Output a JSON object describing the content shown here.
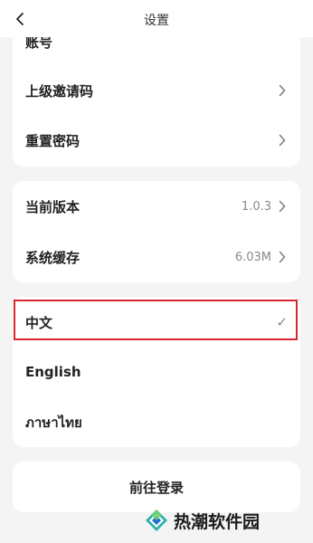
{
  "header": {
    "title": "设置",
    "back_icon": "chevron-left-icon"
  },
  "account_card": {
    "items": [
      {
        "label": "账号"
      },
      {
        "label": "上级邀请码",
        "icon": "chevron-right-icon"
      },
      {
        "label": "重置密码",
        "icon": "chevron-right-icon"
      }
    ]
  },
  "info_card": {
    "items": [
      {
        "label": "当前版本",
        "value": "1.0.3",
        "icon": "chevron-right-icon"
      },
      {
        "label": "系统缓存",
        "value": "6.03M",
        "icon": "chevron-right-icon"
      }
    ]
  },
  "language_card": {
    "items": [
      {
        "label": "中文",
        "selected": true,
        "check": "✓"
      },
      {
        "label": "English"
      },
      {
        "label": "ภาษาไทย"
      }
    ]
  },
  "login": {
    "label": "前往登录"
  },
  "watermark": {
    "text": "热潮软件园",
    "icon": "diamond-logo-icon"
  },
  "colors": {
    "background": "#f4f4f4",
    "card": "#ffffff",
    "highlight_border": "#d7272f",
    "secondary_text": "#8a8a8a"
  }
}
